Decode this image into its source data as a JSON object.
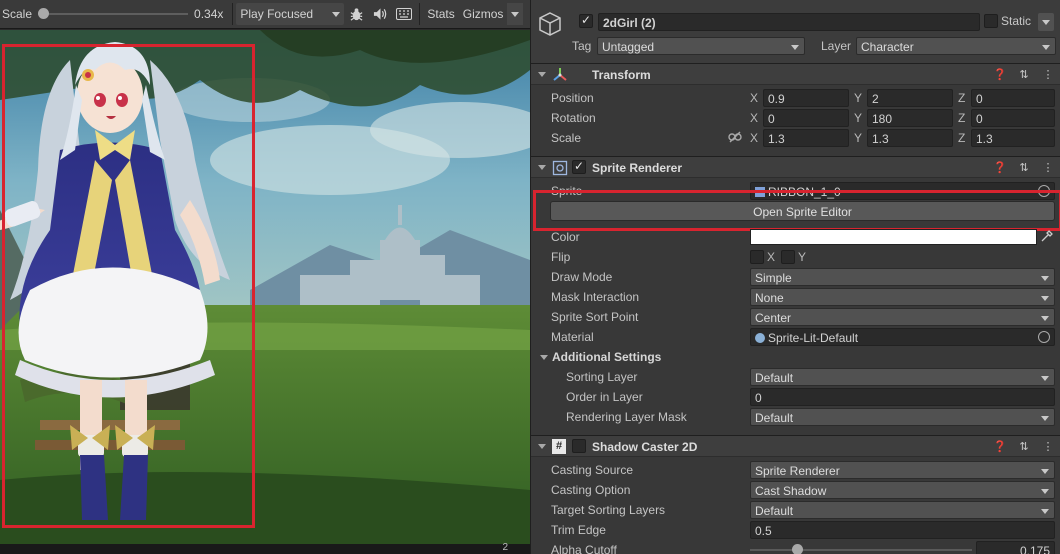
{
  "game_toolbar": {
    "scale_label": "Scale",
    "scale_value": "0.34x",
    "scale_level": 0.0,
    "play_mode": "Play Focused",
    "stats": "Stats",
    "gizmos": "Gizmos",
    "icons": [
      "bug-icon",
      "speaker-icon",
      "keyboard-icon"
    ]
  },
  "game_bottom_text": "2",
  "highlight_color": "#d8242f",
  "object": {
    "name": "2dGirl  (2)",
    "active": true,
    "static_label": "Static",
    "tag_label": "Tag",
    "tag_value": "Untagged",
    "layer_label": "Layer",
    "layer_value": "Character"
  },
  "transform": {
    "title": "Transform",
    "rows": [
      {
        "label": "Position",
        "x": "0.9",
        "y": "2",
        "z": "0"
      },
      {
        "label": "Rotation",
        "x": "0",
        "y": "180",
        "z": "0"
      },
      {
        "label": "Scale",
        "x": "1.3",
        "y": "1.3",
        "z": "1.3"
      }
    ],
    "axis_x": "X",
    "axis_y": "Y",
    "axis_z": "Z"
  },
  "sprite_renderer": {
    "title": "Sprite Renderer",
    "enabled": true,
    "sprite_label": "Sprite",
    "sprite_value": "RIBBON_1_0",
    "open_editor": "Open Sprite Editor",
    "color_label": "Color",
    "color_value": "#ffffff",
    "flip_label": "Flip",
    "flip_x": "X",
    "flip_y": "Y",
    "draw_mode_label": "Draw Mode",
    "draw_mode": "Simple",
    "mask_label": "Mask Interaction",
    "mask_value": "None",
    "sort_point_label": "Sprite Sort Point",
    "sort_point": "Center",
    "material_label": "Material",
    "material_value": "Sprite-Lit-Default",
    "additional_settings": "Additional Settings",
    "sorting_layer_label": "Sorting Layer",
    "sorting_layer": "Default",
    "order_label": "Order in Layer",
    "order_value": "0",
    "rendering_mask_label": "Rendering Layer Mask",
    "rendering_mask": "Default"
  },
  "shadow_caster": {
    "title": "Shadow Caster 2D",
    "casting_source_label": "Casting Source",
    "casting_source": "Sprite Renderer",
    "casting_option_label": "Casting Option",
    "casting_option": "Cast Shadow",
    "target_layers_label": "Target Sorting Layers",
    "target_layers": "Default",
    "trim_edge_label": "Trim Edge",
    "trim_edge": "0.5",
    "alpha_cutoff_label": "Alpha Cutoff",
    "alpha_cutoff": "0.175"
  }
}
